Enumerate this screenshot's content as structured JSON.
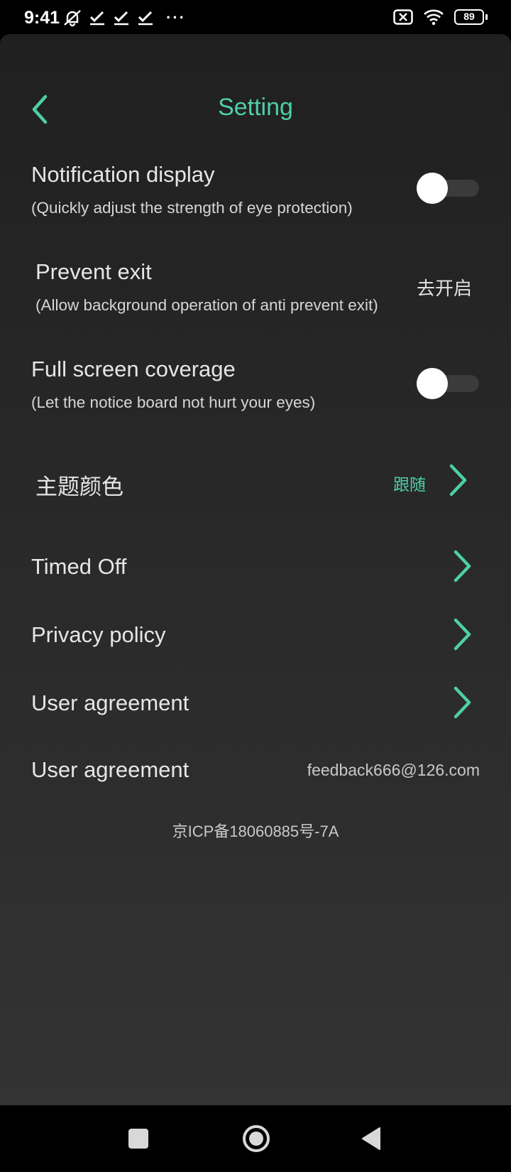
{
  "status_bar": {
    "time": "9:41",
    "battery": "89",
    "more": "···"
  },
  "header": {
    "title": "Setting"
  },
  "settings": {
    "notification_display": {
      "title": "Notification display",
      "subtitle": "(Quickly adjust the strength of eye protection)",
      "enabled": false
    },
    "prevent_exit": {
      "title": "Prevent exit",
      "subtitle": "(Allow background operation of anti prevent exit)",
      "action": "去开启"
    },
    "full_screen_coverage": {
      "title": "Full screen coverage",
      "subtitle": "(Let the notice board not hurt your eyes)",
      "enabled": false
    },
    "theme_color": {
      "title": "主题颜色",
      "value": "跟随"
    },
    "timed_off": {
      "title": "Timed Off"
    },
    "privacy_policy": {
      "title": "Privacy policy"
    },
    "user_agreement": {
      "title": "User agreement"
    },
    "contact": {
      "title": "User agreement",
      "email": "feedback666@126.com"
    }
  },
  "footer": {
    "icp": "京ICP备18060885号-7A"
  },
  "colors": {
    "accent": "#4ecfa8",
    "background_top": "#202020",
    "background_bottom": "#333333"
  }
}
